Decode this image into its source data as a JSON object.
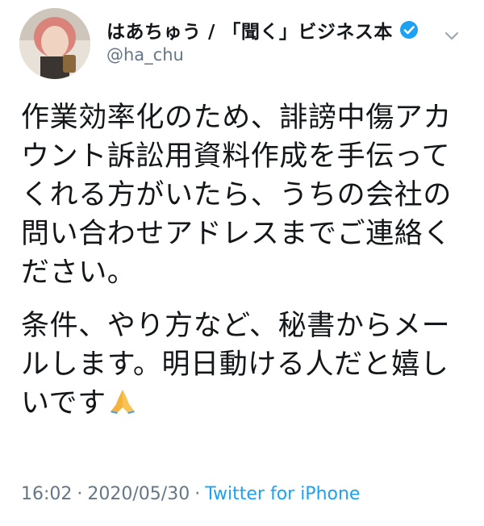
{
  "user": {
    "display_name": "はあちゅう / 「聞く」ビジネス本",
    "handle": "@ha_chu",
    "verified": true
  },
  "icons": {
    "verified": "verified-badge-icon",
    "menu": "chevron-down-icon",
    "emoji": "folded-hands-icon"
  },
  "tweet": {
    "paragraph1": "作業効率化のため、誹謗中傷アカウント訴訟用資料作成を手伝ってくれる方がいたら、うちの会社の問い合わせアドレスまでご連絡ください。",
    "paragraph2": "条件、やり方など、秘書からメールします。明日動ける人だと嬉しいです"
  },
  "meta": {
    "time": "16:02",
    "date": "2020/05/30",
    "separator": "·",
    "source": "Twitter for iPhone"
  },
  "colors": {
    "text": "#14171a",
    "secondary": "#657786",
    "link": "#1da1f2"
  }
}
